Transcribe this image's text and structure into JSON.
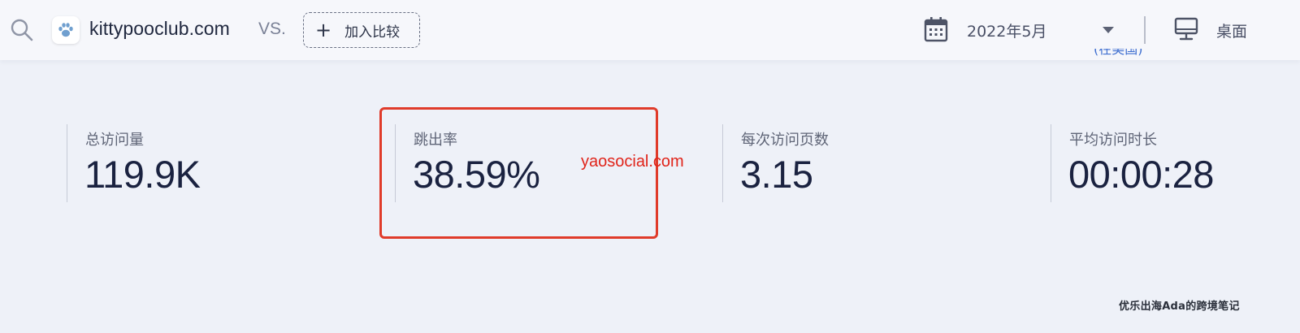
{
  "header": {
    "site_name": "kittypooclub.com",
    "vs_label": "VS.",
    "add_compare_label": "加入比较",
    "date_value": "2022年5月",
    "device_label": "桌面",
    "partial_link_text": "(在美国)"
  },
  "metrics": [
    {
      "label": "总访问量",
      "value": "119.9K"
    },
    {
      "label": "跳出率",
      "value": "38.59%"
    },
    {
      "label": "每次访问页数",
      "value": "3.15"
    },
    {
      "label": "平均访问时长",
      "value": "00:00:28"
    }
  ],
  "annotations": {
    "highlight_color": "#e03b2a",
    "red_watermark": "yaosocial.com",
    "bottom_watermark": "优乐出海Ada的跨境笔记"
  },
  "icons": {
    "search": "search-icon",
    "site_favicon": "paw-icon",
    "add": "plus-icon",
    "calendar": "calendar-icon",
    "dropdown": "chevron-down-icon",
    "device": "monitor-icon"
  },
  "colors": {
    "background": "#eef1f8",
    "topbar": "#f6f7fb",
    "text_dark": "#1a2240",
    "link_blue": "#3f6fd0"
  }
}
